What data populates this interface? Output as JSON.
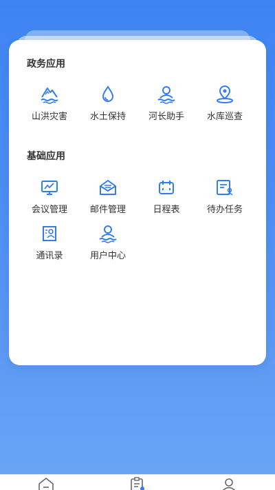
{
  "sections": {
    "gov_title": "政务应用",
    "basic_title": "基础应用"
  },
  "gov_apps": [
    {
      "label": "山洪灾害",
      "icon": "mountain-flood-icon"
    },
    {
      "label": "水土保持",
      "icon": "water-drop-icon"
    },
    {
      "label": "河长助手",
      "icon": "river-chief-icon"
    },
    {
      "label": "水库巡查",
      "icon": "reservoir-location-icon"
    }
  ],
  "basic_apps": [
    {
      "label": "会议管理",
      "icon": "meeting-chart-icon"
    },
    {
      "label": "邮件管理",
      "icon": "mail-icon"
    },
    {
      "label": "日程表",
      "icon": "calendar-icon"
    },
    {
      "label": "待办任务",
      "icon": "todo-task-icon"
    },
    {
      "label": "通讯录",
      "icon": "contacts-icon"
    },
    {
      "label": "用户中心",
      "icon": "user-center-icon"
    }
  ],
  "tabbar": [
    {
      "icon": "home-icon"
    },
    {
      "icon": "clipboard-icon"
    },
    {
      "icon": "profile-icon"
    }
  ],
  "colors": {
    "accent": "#2f7cf6",
    "background_top": "#3e84f1",
    "background_bottom": "#6aa5f5"
  }
}
